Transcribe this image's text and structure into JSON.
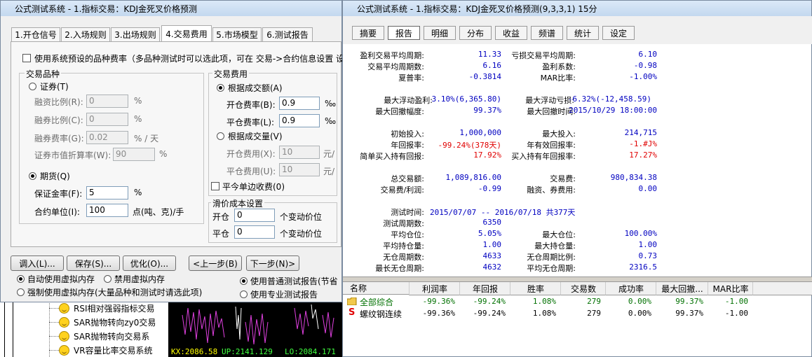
{
  "background": {
    "tree_items": [
      "RSI相对强弱指标交易",
      "SAR抛物转向zy0交易",
      "SAR抛物转向交易系",
      "VR容量比率交易系统"
    ],
    "chart_status": {
      "kx": "KX:2086.58",
      "up": "UP:2141.129",
      "lo": "LO:2084.171"
    }
  },
  "dialog": {
    "title": "公式测试系统 - 1.指标交易：KDJ金死叉价格预测",
    "tabs": [
      "1.开仓信号",
      "2.入场规则",
      "3.出场规则",
      "4.交易费用",
      "5.市场模型",
      "6.测试报告"
    ],
    "use_default_fee_label": "使用系统预设的品种费率（多品种测试时可以选此项，可在 交易->合约信息设置 设",
    "variety_group": {
      "title": "交易品种",
      "securities": "证券(T)",
      "margin_ratio_label": "融资比例(R):",
      "margin_ratio_value": "0",
      "pct1": "%",
      "short_ratio_label": "融券比例(C):",
      "short_ratio_value": "0",
      "pct2": "%",
      "short_rate_label": "融券费率(G):",
      "short_rate_value": "0.02",
      "per_day": "% / 天",
      "discount_label": "证券市值折算率(W):",
      "discount_value": "90",
      "pct3": "%",
      "futures": "期货(Q)",
      "deposit_label": "保证金率(F):",
      "deposit_value": "5",
      "pct4": "%",
      "unit_label": "合约单位(I):",
      "unit_value": "100",
      "unit_suffix": "点(吨、克)/手"
    },
    "fee_group": {
      "title": "交易费用",
      "by_amount": "根据成交额(A)",
      "open_rate_label": "开仓费率(B):",
      "open_rate_value": "0.9",
      "open_rate_unit": "‰",
      "close_rate_label": "平仓费率(L):",
      "close_rate_value": "0.9",
      "close_rate_unit": "‰",
      "by_volume": "根据成交量(V)",
      "open_fee_label": "开仓费用(X):",
      "open_fee_value": "10",
      "open_fee_unit": "元/",
      "close_fee_label": "平仓费用(U):",
      "close_fee_value": "10",
      "close_fee_unit": "元/",
      "single_side": "平今单边收费(0)"
    },
    "slippage_group": {
      "title": "滑价成本设置",
      "open_label": "开仓",
      "open_value": "0",
      "open_unit": "个变动价位",
      "close_label": "平仓",
      "close_value": "0",
      "close_unit": "个变动价位"
    },
    "buttons": {
      "import": "调入(L)...",
      "save": "保存(S)...",
      "optimize": "优化(O)...",
      "prev": "<上一步(B)",
      "next": "下一步(N)>"
    },
    "memory": {
      "auto": "自动使用虚拟内存",
      "disable": "禁用虚拟内存",
      "force": "强制使用虚拟内存(大量品种和测试时请选此项)"
    },
    "report_mode": {
      "normal": "使用普通测试报告(节省",
      "pro": "使用专业测试报告"
    }
  },
  "report": {
    "title": "公式测试系统 - 1.指标交易：KDJ金死叉价格预测(9,3,3,1) 15分",
    "tabs": [
      "摘要",
      "报告",
      "明细",
      "分布",
      "收益",
      "频谱",
      "统计",
      "设定"
    ],
    "stats": {
      "win_avg_period_label": "盈利交易平均周期:",
      "win_avg_period": "11.33",
      "loss_avg_period_label": "亏损交易平均周期:",
      "loss_avg_period": "6.10",
      "avg_period_label": "交易平均周期数:",
      "avg_period": "6.16",
      "profit_factor_label": "盈利系数:",
      "profit_factor": "-0.98",
      "sharpe_label": "夏普率:",
      "sharpe": "-0.3814",
      "mar_label": "MAR比率:",
      "mar": "-1.00%",
      "max_float_profit_label": "最大浮动盈利:",
      "max_float_profit": "3.10%(6,365.80)",
      "max_float_loss_label": "最大浮动亏损:",
      "max_float_loss": "-6.32%(-12,458.59)",
      "max_drawdown_label": "最大回撤幅度:",
      "max_drawdown": "99.37%",
      "max_drawdown_time_label": "最大回撤时间:",
      "max_drawdown_time": "2015/10/29 18:00:00",
      "initial_label": "初始投入:",
      "initial": "1,000,000",
      "max_invest_label": "最大投入:",
      "max_invest": "214,715",
      "annual_label": "年回报率:",
      "annual": "-99.24%(378天)",
      "effective_annual_label": "年有效回报率:",
      "effective_annual": "-1.#J%",
      "simple_buy_label": "简单买入持有回报:",
      "simple_buy": "17.92%",
      "buy_hold_annual_label": "买入持有年回报率:",
      "buy_hold_annual": "17.27%",
      "total_amount_label": "总交易额:",
      "total_amount": "1,089,816.00",
      "fee_label": "交易费:",
      "fee": "980,834.38",
      "fee_profit_label": "交易费/利润:",
      "fee_profit": "-0.99",
      "finance_fee_label": "融资、券费用:",
      "finance_fee": "0.00",
      "test_time_label": "测试时间:",
      "test_time": "2015/07/07 -- 2016/07/18  共377天",
      "test_periods_label": "测试周期数:",
      "test_periods": "6350",
      "avg_position_label": "平均仓位:",
      "avg_position": "5.05%",
      "max_position_label": "最大仓位:",
      "max_position": "100.00%",
      "avg_holding_label": "平均持仓量:",
      "avg_holding": "1.00",
      "max_holding_label": "最大持仓量:",
      "max_holding": "1.00",
      "no_position_periods_label": "无仓周期数:",
      "no_position_periods": "4633",
      "no_position_ratio_label": "无仓周期比例:",
      "no_position_ratio": "0.73",
      "longest_no_position_label": "最长无仓周期:",
      "longest_no_position": "4632",
      "avg_no_position_label": "平均无仓周期:",
      "avg_no_position": "2316.5"
    },
    "table": {
      "headers": [
        "名称",
        "利润率",
        "年回报",
        "胜率",
        "交易数",
        "成功率",
        "最大回撤...",
        "MAR比率"
      ],
      "rows": [
        {
          "name": "全部综合",
          "profit": "-99.36%",
          "annual": "-99.24%",
          "win": "1.08%",
          "trades": "279",
          "success": "0.00%",
          "drawdown": "99.37%",
          "mar": "-1.00"
        },
        {
          "name": "螺纹钢连续",
          "profit": "-99.36%",
          "annual": "-99.24%",
          "win": "1.08%",
          "trades": "279",
          "success": "0.00%",
          "drawdown": "99.37%",
          "mar": "-1.00"
        }
      ]
    }
  }
}
